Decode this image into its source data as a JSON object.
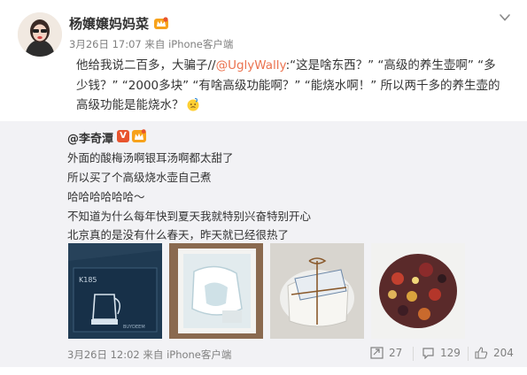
{
  "post": {
    "username": "杨嬢嬢妈妈菜",
    "time": "3月26日 17:07",
    "source_prefix": "来自",
    "source": "iPhone客户端",
    "text_before_mention": "他给我说二百多，大骗子//",
    "mention": "@UglyWally",
    "text_after_mention": ":“这是啥东西？” “高级的养生壶啊” “多少钱？” “2000多块” “有啥高级功能啊？” “能烧水啊！” 所以两千多的养生壶的高级功能是能烧水？"
  },
  "repost": {
    "username": "@李奇潭",
    "lines": [
      "外面的酸梅汤啊银耳汤啊都太甜了",
      "所以买了个高级烧水壶自己煮",
      "哈哈哈哈哈哈～",
      "不知道为什么每年快到夏天我就特别兴奋特别开心",
      "北京真的是没有什么春天，昨天就已经很热了"
    ],
    "time": "3月26日 12:02",
    "source_prefix": "来自",
    "source": "iPhone客户端",
    "thumb_box_label": "K185",
    "thumb_box_brand": "BUYDEEM",
    "actions": {
      "reposts": "27",
      "comments": "129",
      "likes": "204"
    }
  },
  "colors": {
    "mention": "#eb7350",
    "repost_bg": "#f2f2f5",
    "meta": "#808080"
  },
  "icons": [
    "avatar",
    "crown-badge-icon",
    "chevron-down-icon",
    "verified-v-icon",
    "vip-badge-icon",
    "thinking-emoji-icon",
    "repost-icon",
    "comment-icon",
    "like-icon"
  ]
}
